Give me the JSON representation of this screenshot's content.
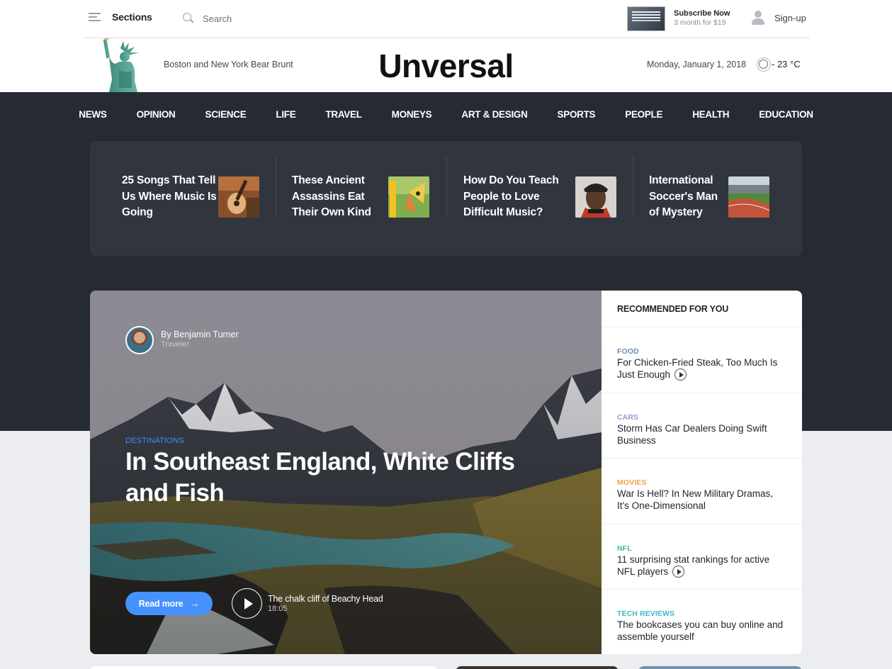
{
  "header": {
    "sections_label": "Sections",
    "search_placeholder": "Search",
    "subscribe_title": "Subscribe Now",
    "subscribe_price": "3 month for $19",
    "signup_label": "Sign-up"
  },
  "masthead": {
    "tagline": "Boston and New York Bear Brunt",
    "logo": "Unversal",
    "date": "Monday, January 1, 2018",
    "temperature": "- 23 °C"
  },
  "nav": [
    "NEWS",
    "OPINION",
    "SCIENCE",
    "LIFE",
    "TRAVEL",
    "MONEYS",
    "ART & DESIGN",
    "SPORTS",
    "PEOPLE",
    "HEALTH",
    "EDUCATION"
  ],
  "strip": [
    {
      "title": "25 Songs That Tell Us Where Music Is Going",
      "icon": "guitar-thumb"
    },
    {
      "title": "These Ancient Assassins Eat Their Own Kind",
      "icon": "butterfly-thumb"
    },
    {
      "title": "How Do You Teach People to Love Difficult Music?",
      "icon": "portrait-thumb"
    },
    {
      "title": "International Soccer's Man of Mystery",
      "icon": "stadium-thumb"
    }
  ],
  "hero": {
    "author_name": "By Benjamin Turner",
    "author_role": "Traveler",
    "category": "DESTINATIONS",
    "title": "In Southeast England, White Cliffs and Fish",
    "read_more": "Read more",
    "arrow": "→",
    "video_title": "The chalk cliff of Beachy Head",
    "video_time": "18:05"
  },
  "recommended": {
    "heading": "RECOMMENDED FOR YOU",
    "items": [
      {
        "category": "FOOD",
        "color": "#6b8fb0",
        "title": "For Chicken-Fried Steak, Too Much Is Just Enough",
        "video": true
      },
      {
        "category": "CARS",
        "color": "#a58fd6",
        "title": "Storm Has Car Dealers Doing Swift Business",
        "video": false
      },
      {
        "category": "MOVIES",
        "color": "#f0a04b",
        "title": "War Is Hell? In New Military Dramas, It's One-Dimensional",
        "video": false
      },
      {
        "category": "NFL",
        "color": "#3fbf8f",
        "title": "11 surprising stat rankings for active NFL players",
        "video": true
      },
      {
        "category": "TECH REVIEWS",
        "color": "#3fb8c9",
        "title": "The bookcases you can buy online and assemble yourself",
        "video": false
      }
    ]
  },
  "colors": {
    "dark_band": "#262b33",
    "strip_bg": "#30353e",
    "accent_blue": "#4592ff"
  }
}
